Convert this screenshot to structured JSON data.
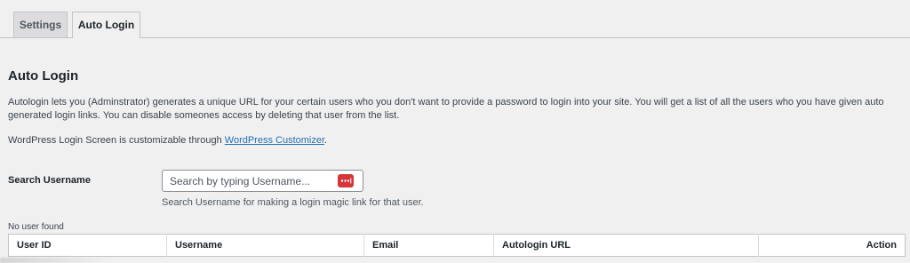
{
  "tabs": [
    {
      "label": "Settings",
      "active": false
    },
    {
      "label": "Auto Login",
      "active": true
    }
  ],
  "main": {
    "heading": "Auto Login",
    "description": "Autologin lets you (Adminstrator) generates a unique URL for your certain users who you don't want to provide a password to login into your site. You will get a list of all the users who you have given auto generated login links. You can disable someones access by deleting that user from the list.",
    "customizer_prefix": "WordPress Login Screen is customizable through ",
    "customizer_link": "WordPress Customizer",
    "customizer_suffix": "."
  },
  "search": {
    "label": "Search Username",
    "placeholder": "Search by typing Username...",
    "value": "",
    "hint": "Search Username for making a login magic link for that user.",
    "icon": "password-manager-icon"
  },
  "table": {
    "status": "No user found",
    "columns": [
      "User ID",
      "Username",
      "Email",
      "Autologin URL",
      "Action"
    ],
    "rows": []
  },
  "colors": {
    "accent": "#2271b1",
    "password_icon": "#d63638",
    "background": "#f0f0f1"
  }
}
